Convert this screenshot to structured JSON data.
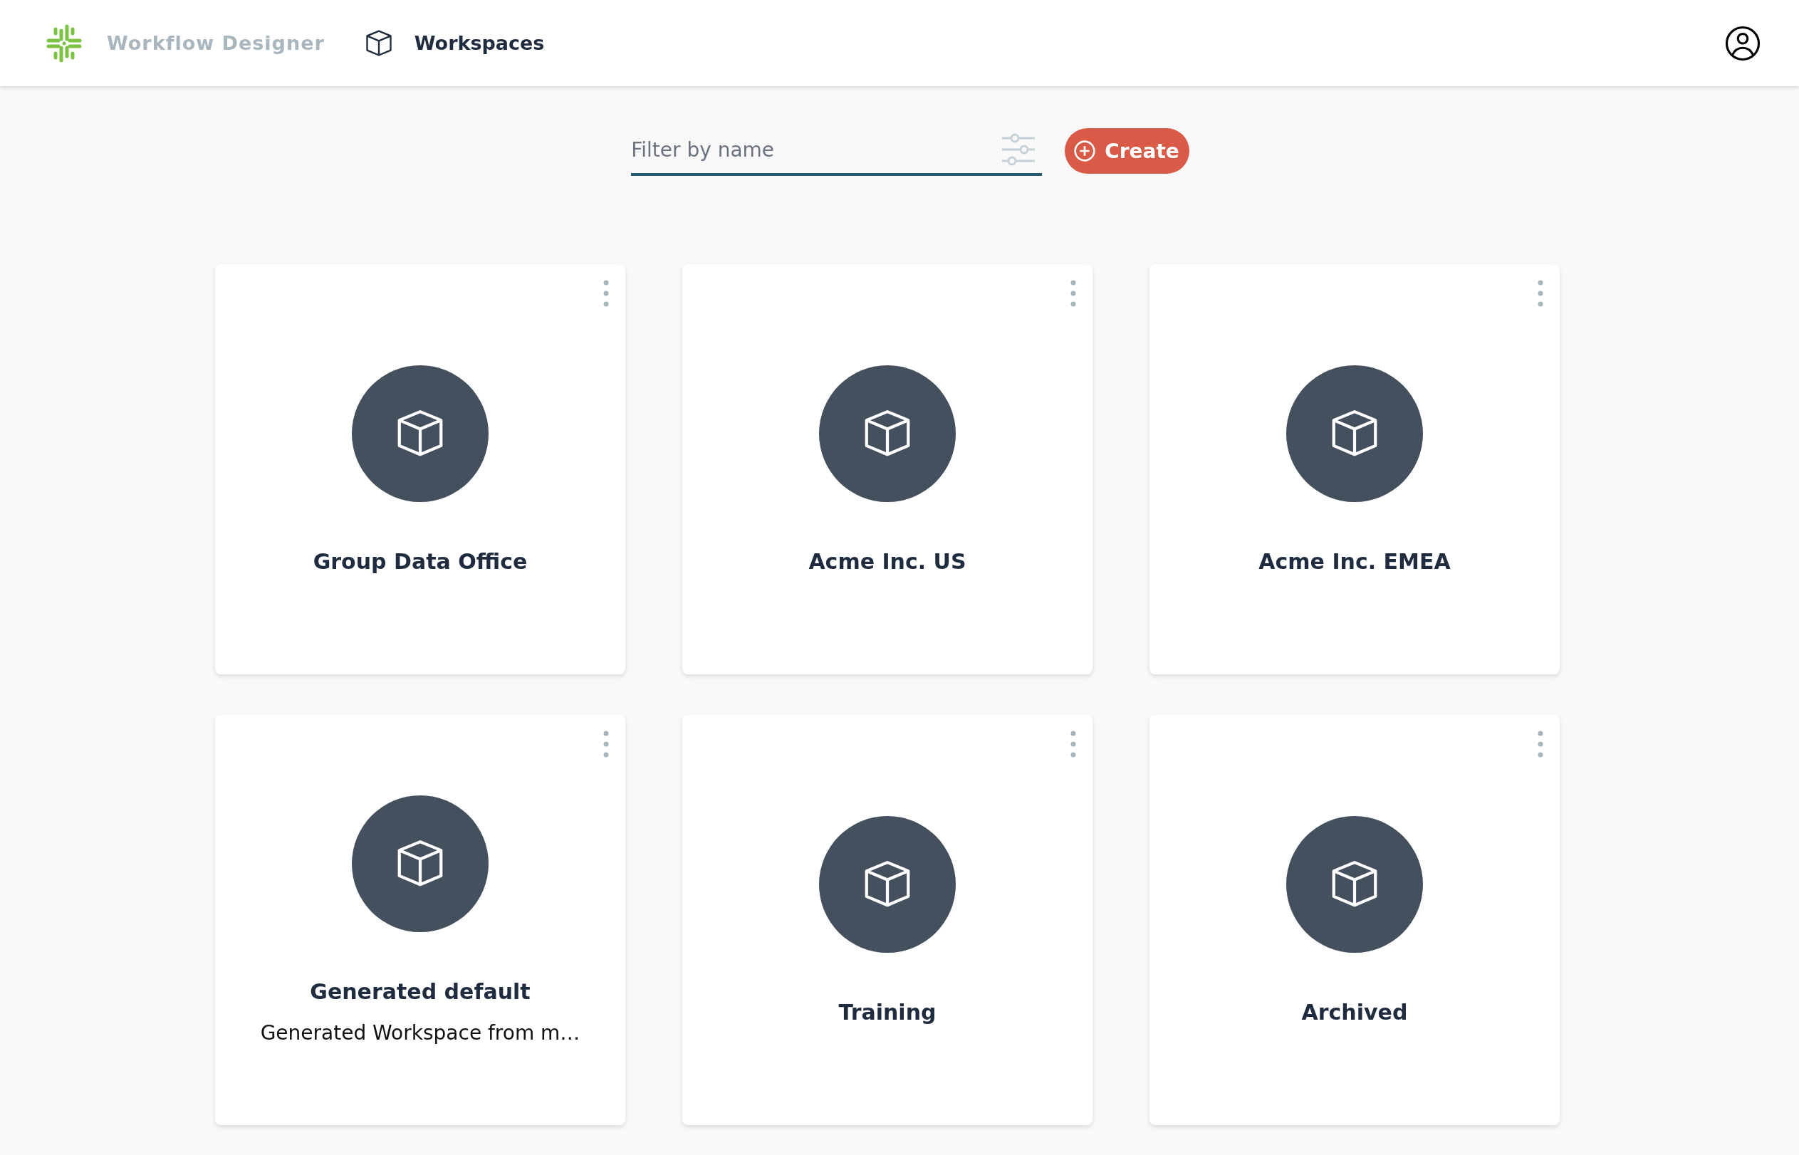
{
  "header": {
    "app_name": "Workflow Designer",
    "nav_label": "Workspaces"
  },
  "toolbar": {
    "filter": {
      "placeholder": "Filter by name"
    },
    "create_button": "Create"
  },
  "workspaces": [
    {
      "name": "Group Data Office"
    },
    {
      "name": "Acme Inc. US"
    },
    {
      "name": "Acme Inc. EMEA"
    },
    {
      "name": "Generated default",
      "description": "Generated Workspace from m…"
    },
    {
      "name": "Training"
    },
    {
      "name": "Archived"
    }
  ]
}
